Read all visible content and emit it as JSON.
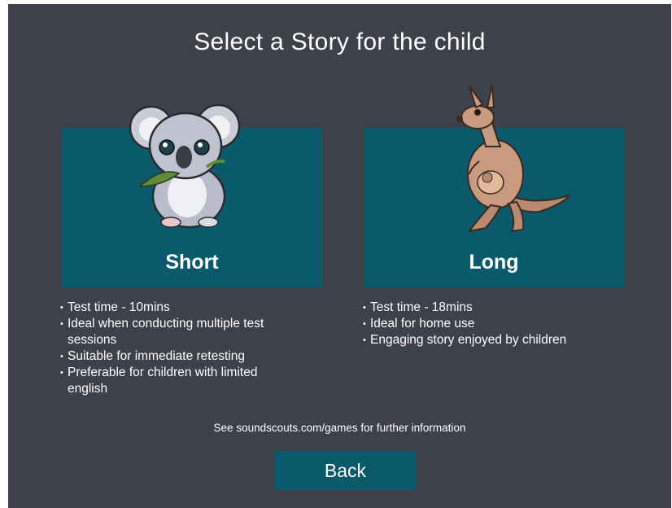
{
  "title": "Select a Story for the child",
  "colors": {
    "background": "#3e404a",
    "card": "#0b5a6c",
    "text": "#ffffff"
  },
  "stories": [
    {
      "label": "Short",
      "icon": "koala-icon",
      "bullets": [
        "Test time - 10mins",
        "Ideal when conducting multiple test sessions",
        "Suitable for immediate retesting",
        "Preferable for children with limited english"
      ]
    },
    {
      "label": "Long",
      "icon": "kangaroo-icon",
      "bullets": [
        "Test time - 18mins",
        "Ideal for home use",
        "Engaging story enjoyed by children"
      ]
    }
  ],
  "info_text": "See soundscouts.com/games for further information",
  "back_label": "Back"
}
